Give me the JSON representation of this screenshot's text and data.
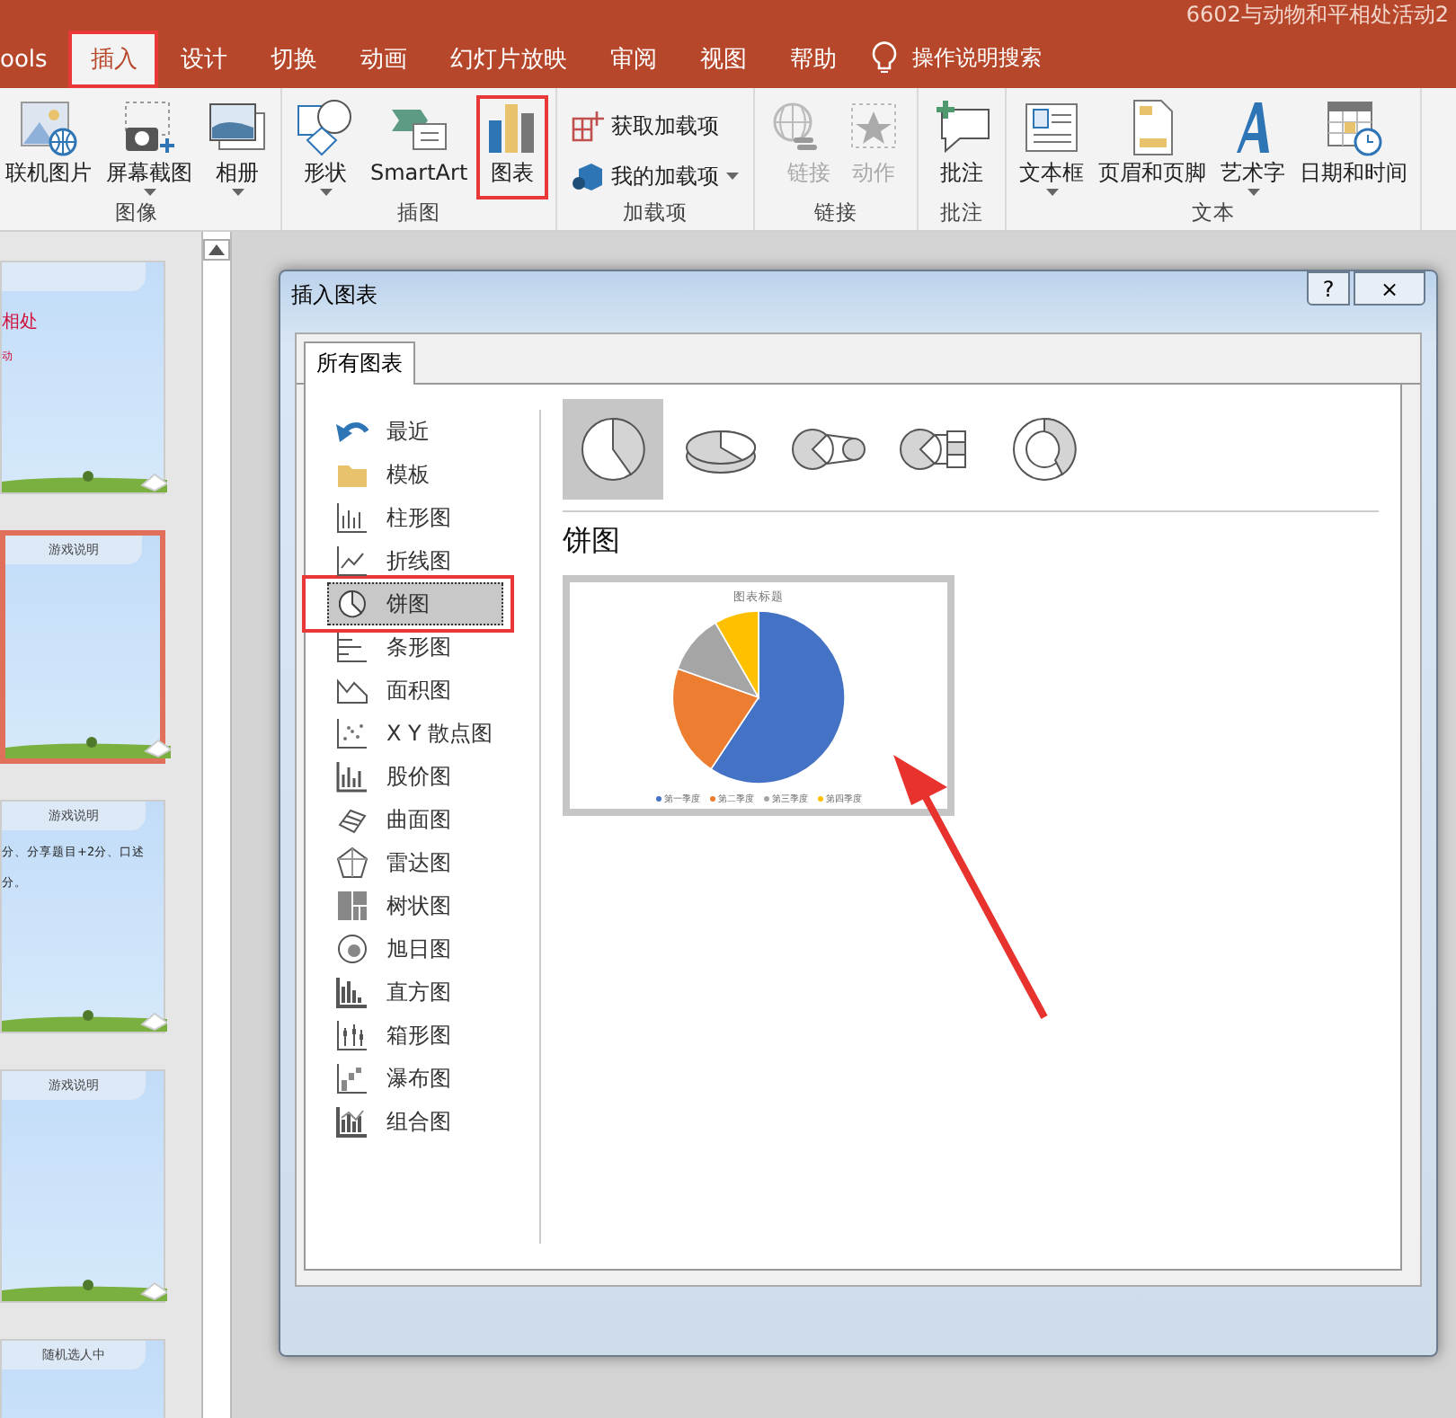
{
  "window": {
    "title": "6602与动物和平相处活动2"
  },
  "ribbon_tabs": [
    {
      "label": "ools",
      "selected": false
    },
    {
      "label": "插入",
      "selected": true,
      "highlighted": true
    },
    {
      "label": "设计",
      "selected": false
    },
    {
      "label": "切换",
      "selected": false
    },
    {
      "label": "动画",
      "selected": false
    },
    {
      "label": "幻灯片放映",
      "selected": false
    },
    {
      "label": "审阅",
      "selected": false
    },
    {
      "label": "视图",
      "selected": false
    },
    {
      "label": "帮助",
      "selected": false
    }
  ],
  "tell_me": "操作说明搜索",
  "ribbon_groups": [
    {
      "label": "图像",
      "buttons": [
        {
          "kind": "large",
          "label": "联机图片",
          "disabled": false
        },
        {
          "kind": "large",
          "label": "屏幕截图",
          "disabled": false,
          "dropdown": true
        },
        {
          "kind": "large",
          "label": "相册",
          "disabled": false,
          "dropdown": true
        }
      ]
    },
    {
      "label": "插图",
      "buttons": [
        {
          "kind": "large",
          "label": "形状",
          "disabled": false,
          "dropdown": true
        },
        {
          "kind": "large",
          "label": "SmartArt",
          "disabled": false
        },
        {
          "kind": "large",
          "label": "图表",
          "disabled": false,
          "highlighted": true
        }
      ]
    },
    {
      "label": "加载项",
      "buttons": [
        {
          "kind": "small",
          "label": "获取加载项",
          "disabled": false
        },
        {
          "kind": "small",
          "label": "我的加载项",
          "disabled": false,
          "dropdown": true
        }
      ]
    },
    {
      "label": "链接",
      "buttons": [
        {
          "kind": "narrow",
          "label": "链接",
          "disabled": true
        },
        {
          "kind": "large",
          "label": "动作",
          "disabled": true
        }
      ]
    },
    {
      "label": "批注",
      "buttons": [
        {
          "kind": "large",
          "label": "批注",
          "disabled": false
        }
      ]
    },
    {
      "label": "文本",
      "buttons": [
        {
          "kind": "large",
          "label": "文本框",
          "disabled": false,
          "dropdown": true
        },
        {
          "kind": "large",
          "label": "页眉和页脚",
          "disabled": false
        },
        {
          "kind": "large",
          "label": "艺术字",
          "disabled": false,
          "dropdown": true
        },
        {
          "kind": "large",
          "label": "日期和时间",
          "disabled": false
        }
      ]
    }
  ],
  "slides": [
    {
      "selected": false,
      "title": "相处",
      "texts": [
        "动"
      ]
    },
    {
      "selected": true,
      "header": "游戏说明"
    },
    {
      "selected": false,
      "header": "游戏说明",
      "texts": [
        "分、分享题目+2分、口述",
        "分。"
      ]
    },
    {
      "selected": false,
      "header": "游戏说明"
    },
    {
      "selected": false,
      "header": "随机选人中"
    }
  ],
  "dialog": {
    "title": "插入图表",
    "help_button": "?",
    "close_button": "×",
    "tabs": [
      {
        "label": "所有图表",
        "selected": true
      }
    ],
    "chart_types": [
      {
        "label": "最近",
        "selected": false
      },
      {
        "label": "模板",
        "selected": false
      },
      {
        "label": "柱形图",
        "selected": false
      },
      {
        "label": "折线图",
        "selected": false
      },
      {
        "label": "饼图",
        "selected": true,
        "highlighted": true
      },
      {
        "label": "条形图",
        "selected": false
      },
      {
        "label": "面积图",
        "selected": false
      },
      {
        "label": "X Y 散点图",
        "selected": false
      },
      {
        "label": "股价图",
        "selected": false
      },
      {
        "label": "曲面图",
        "selected": false
      },
      {
        "label": "雷达图",
        "selected": false
      },
      {
        "label": "树状图",
        "selected": false
      },
      {
        "label": "旭日图",
        "selected": false
      },
      {
        "label": "直方图",
        "selected": false
      },
      {
        "label": "箱形图",
        "selected": false
      },
      {
        "label": "瀑布图",
        "selected": false
      },
      {
        "label": "组合图",
        "selected": false
      }
    ],
    "subtypes": [
      {
        "selected": true
      },
      {
        "selected": false
      },
      {
        "selected": false
      },
      {
        "selected": false
      },
      {
        "selected": false
      }
    ],
    "heading": "饼图",
    "preview": {
      "title": "图表标题",
      "legend": [
        {
          "label": "第一季度",
          "color": "#4472c4"
        },
        {
          "label": "第二季度",
          "color": "#ed7d31"
        },
        {
          "label": "第三季度",
          "color": "#a5a5a5"
        },
        {
          "label": "第四季度",
          "color": "#ffc000"
        }
      ]
    }
  }
}
